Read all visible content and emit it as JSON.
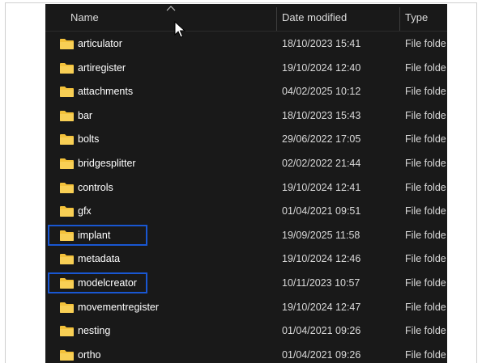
{
  "columns": {
    "name": "Name",
    "date": "Date modified",
    "type": "Type"
  },
  "colors": {
    "background": "#191919",
    "folder": "#f3c13a",
    "highlight": "#1957d2"
  },
  "icons": {
    "folder": "folder-icon",
    "sort": "sort-ascending-icon",
    "cursor": "mouse-pointer-icon"
  },
  "rows": [
    {
      "name": "articulator",
      "date": "18/10/2023 15:41",
      "type": "File folde",
      "highlighted": false
    },
    {
      "name": "artiregister",
      "date": "19/10/2024 12:40",
      "type": "File folde",
      "highlighted": false
    },
    {
      "name": "attachments",
      "date": "04/02/2025 10:12",
      "type": "File folde",
      "highlighted": false
    },
    {
      "name": "bar",
      "date": "18/10/2023 15:43",
      "type": "File folde",
      "highlighted": false
    },
    {
      "name": "bolts",
      "date": "29/06/2022 17:05",
      "type": "File folde",
      "highlighted": false
    },
    {
      "name": "bridgesplitter",
      "date": "02/02/2022 21:44",
      "type": "File folde",
      "highlighted": false
    },
    {
      "name": "controls",
      "date": "19/10/2024 12:41",
      "type": "File folde",
      "highlighted": false
    },
    {
      "name": "gfx",
      "date": "01/04/2021 09:51",
      "type": "File folde",
      "highlighted": false
    },
    {
      "name": "implant",
      "date": "19/09/2025 11:58",
      "type": "File folde",
      "highlighted": true
    },
    {
      "name": "metadata",
      "date": "19/10/2024 12:46",
      "type": "File folde",
      "highlighted": false
    },
    {
      "name": "modelcreator",
      "date": "10/11/2023 10:57",
      "type": "File folde",
      "highlighted": true
    },
    {
      "name": "movementregister",
      "date": "19/10/2024 12:47",
      "type": "File folde",
      "highlighted": false
    },
    {
      "name": "nesting",
      "date": "01/04/2021 09:26",
      "type": "File folde",
      "highlighted": false
    },
    {
      "name": "ortho",
      "date": "01/04/2021 09:26",
      "type": "File folde",
      "highlighted": false
    }
  ]
}
